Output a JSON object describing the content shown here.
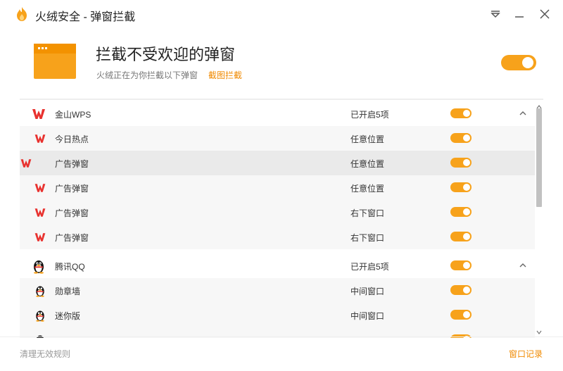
{
  "window": {
    "title": "火绒安全 - 弹窗拦截"
  },
  "header": {
    "title": "拦截不受欢迎的弹窗",
    "subtitle": "火绒正在为你拦截以下弹窗",
    "link": "截图拦截",
    "enabled": true
  },
  "groups": [
    {
      "name": "金山WPS",
      "status": "已开启5项",
      "icon": "wps-icon",
      "items": [
        {
          "name": "今日热点",
          "position": "任意位置"
        },
        {
          "name": "广告弹窗",
          "position": "任意位置"
        },
        {
          "name": "广告弹窗",
          "position": "任意位置"
        },
        {
          "name": "广告弹窗",
          "position": "右下窗口"
        },
        {
          "name": "广告弹窗",
          "position": "右下窗口"
        }
      ]
    },
    {
      "name": "腾讯QQ",
      "status": "已开启5项",
      "icon": "qq-penguin-icon",
      "items": [
        {
          "name": "勋章墙",
          "position": "中间窗口"
        },
        {
          "name": "迷你版",
          "position": "中间窗口"
        }
      ]
    }
  ],
  "footer": {
    "left": "清理无效规则",
    "right": "窗口记录"
  },
  "colors": {
    "accent": "#f7a21b",
    "link": "#f08a00",
    "wps_red": "#e8312e"
  }
}
